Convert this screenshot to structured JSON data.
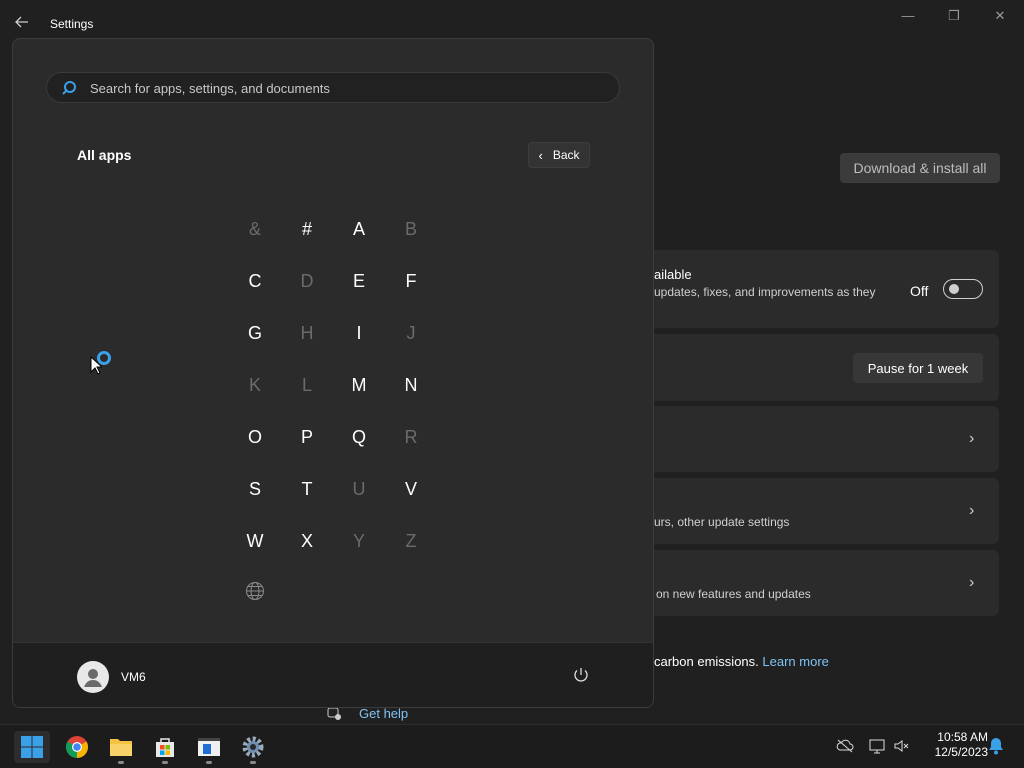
{
  "settings": {
    "title": "Settings",
    "download_label": "Download & install all",
    "card1_title": "ailable",
    "card1_sub": "updates, fixes, and improvements as they",
    "toggle_state": "Off",
    "pause_label": "Pause for 1 week",
    "card4_sub": "urs, other update settings",
    "card5_sub": "on new features and updates",
    "carbon_text": "carbon emissions.",
    "learn_more": "Learn more",
    "get_help": "Get help"
  },
  "start_menu": {
    "search_placeholder": "Search for apps, settings, and documents",
    "title": "All apps",
    "back_label": "Back",
    "letters": [
      {
        "char": "&",
        "enabled": false
      },
      {
        "char": "#",
        "enabled": true
      },
      {
        "char": "A",
        "enabled": true
      },
      {
        "char": "B",
        "enabled": false
      },
      {
        "char": "C",
        "enabled": true
      },
      {
        "char": "D",
        "enabled": false
      },
      {
        "char": "E",
        "enabled": true
      },
      {
        "char": "F",
        "enabled": true
      },
      {
        "char": "G",
        "enabled": true
      },
      {
        "char": "H",
        "enabled": false
      },
      {
        "char": "I",
        "enabled": true
      },
      {
        "char": "J",
        "enabled": false
      },
      {
        "char": "K",
        "enabled": false
      },
      {
        "char": "L",
        "enabled": false
      },
      {
        "char": "M",
        "enabled": true
      },
      {
        "char": "N",
        "enabled": true
      },
      {
        "char": "O",
        "enabled": true
      },
      {
        "char": "P",
        "enabled": true
      },
      {
        "char": "Q",
        "enabled": true
      },
      {
        "char": "R",
        "enabled": false
      },
      {
        "char": "S",
        "enabled": true
      },
      {
        "char": "T",
        "enabled": true
      },
      {
        "char": "U",
        "enabled": false
      },
      {
        "char": "V",
        "enabled": true
      },
      {
        "char": "W",
        "enabled": true
      },
      {
        "char": "X",
        "enabled": true
      },
      {
        "char": "Y",
        "enabled": false
      },
      {
        "char": "Z",
        "enabled": false
      }
    ],
    "user_name": "VM6"
  },
  "taskbar": {
    "time": "10:58 AM",
    "date": "12/5/2023"
  },
  "colors": {
    "accent": "#3aa0e8",
    "link": "#7fc3f5"
  }
}
